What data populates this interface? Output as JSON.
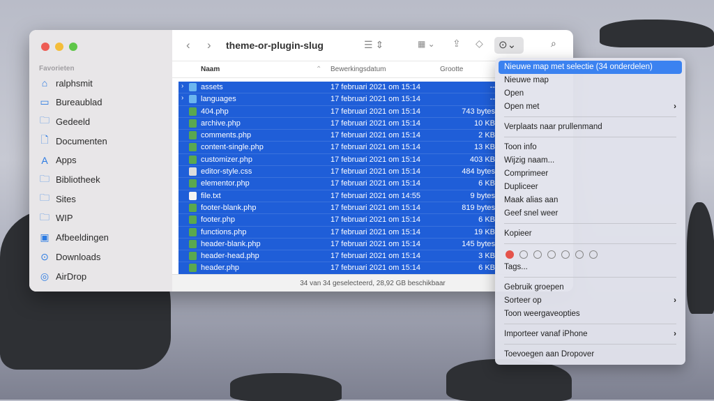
{
  "window": {
    "title": "theme-or-plugin-slug",
    "status": "34 van 34 geselecteerd, 28,92 GB beschikbaar"
  },
  "sidebar": {
    "section": "Favorieten",
    "items": [
      {
        "label": "ralphsmit",
        "icon": "house-icon",
        "glyph": "⌂"
      },
      {
        "label": "Bureaublad",
        "icon": "desktop-icon",
        "glyph": "▭"
      },
      {
        "label": "Gedeeld",
        "icon": "folder-icon",
        "glyph": "🗀"
      },
      {
        "label": "Documenten",
        "icon": "document-icon",
        "glyph": "🗋"
      },
      {
        "label": "Apps",
        "icon": "apps-icon",
        "glyph": "A"
      },
      {
        "label": "Bibliotheek",
        "icon": "folder-icon",
        "glyph": "🗀"
      },
      {
        "label": "Sites",
        "icon": "folder-icon",
        "glyph": "🗀"
      },
      {
        "label": "WIP",
        "icon": "folder-icon",
        "glyph": "🗀"
      },
      {
        "label": "Afbeeldingen",
        "icon": "photo-icon",
        "glyph": "▣"
      },
      {
        "label": "Downloads",
        "icon": "download-icon",
        "glyph": "⊙"
      },
      {
        "label": "AirDrop",
        "icon": "airdrop-icon",
        "glyph": "◎"
      }
    ]
  },
  "columns": {
    "name": "Naam",
    "date": "Bewerkingsdatum",
    "size": "Grootte"
  },
  "files": [
    {
      "name": "assets",
      "date": "17 februari 2021 om 15:14",
      "size": "--",
      "type": "folder"
    },
    {
      "name": "languages",
      "date": "17 februari 2021 om 15:14",
      "size": "--",
      "type": "folder"
    },
    {
      "name": "404.php",
      "date": "17 februari 2021 om 15:14",
      "size": "743 bytes",
      "type": "php"
    },
    {
      "name": "archive.php",
      "date": "17 februari 2021 om 15:14",
      "size": "10 KB",
      "type": "php"
    },
    {
      "name": "comments.php",
      "date": "17 februari 2021 om 15:14",
      "size": "2 KB",
      "type": "php"
    },
    {
      "name": "content-single.php",
      "date": "17 februari 2021 om 15:14",
      "size": "13 KB",
      "type": "php"
    },
    {
      "name": "customizer.php",
      "date": "17 februari 2021 om 15:14",
      "size": "403 KB",
      "type": "php"
    },
    {
      "name": "editor-style.css",
      "date": "17 februari 2021 om 15:14",
      "size": "484 bytes",
      "type": "css"
    },
    {
      "name": "elementor.php",
      "date": "17 februari 2021 om 15:14",
      "size": "6 KB",
      "type": "php"
    },
    {
      "name": "file.txt",
      "date": "17 februari 2021 om 14:55",
      "size": "9 bytes",
      "type": "txt"
    },
    {
      "name": "footer-blank.php",
      "date": "17 februari 2021 om 15:14",
      "size": "819 bytes",
      "type": "php"
    },
    {
      "name": "footer.php",
      "date": "17 februari 2021 om 15:14",
      "size": "6 KB",
      "type": "php"
    },
    {
      "name": "functions.php",
      "date": "17 februari 2021 om 15:14",
      "size": "19 KB",
      "type": "php"
    },
    {
      "name": "header-blank.php",
      "date": "17 februari 2021 om 15:14",
      "size": "145 bytes",
      "type": "php"
    },
    {
      "name": "header-head.php",
      "date": "17 februari 2021 om 15:14",
      "size": "3 KB",
      "type": "php"
    },
    {
      "name": "header.php",
      "date": "17 februari 2021 om 15:14",
      "size": "6 KB",
      "type": "php"
    }
  ],
  "menu": {
    "groups": [
      [
        "Nieuwe map met selectie (34 onderdelen)",
        "Nieuwe map",
        "Open",
        "Open met"
      ],
      [
        "Verplaats naar prullenmand"
      ],
      [
        "Toon info",
        "Wijzig naam...",
        "Comprimeer",
        "Dupliceer",
        "Maak alias aan",
        "Geef snel weer"
      ],
      [
        "Kopieer"
      ],
      [
        "Tags..."
      ],
      [
        "Gebruik groepen",
        "Sorteer op",
        "Toon weergaveopties"
      ],
      [
        "Importeer vanaf iPhone"
      ],
      [
        "Toevoegen aan Dropover"
      ]
    ],
    "submenus": [
      "Open met",
      "Sorteer op",
      "Importeer vanaf iPhone"
    ],
    "tag_colors": [
      "#e5534b",
      "none",
      "none",
      "none",
      "none",
      "none",
      "none"
    ]
  }
}
